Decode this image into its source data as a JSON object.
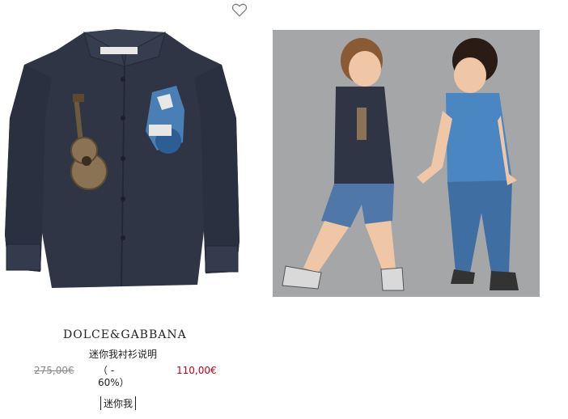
{
  "product": {
    "brand": "DOLCE&GABBANA",
    "name": "迷你我衬衫说明",
    "old_price": "275,00€",
    "discount": "（ - 60%）",
    "new_price": "110,00€",
    "tag": "迷你我"
  },
  "icons": {
    "favorite": "heart-outline-icon"
  },
  "colors": {
    "sale_price": "#c0001a",
    "old_price": "#888888",
    "photo_background": "#a7a9ab",
    "denim_dark": "#2f3544"
  }
}
